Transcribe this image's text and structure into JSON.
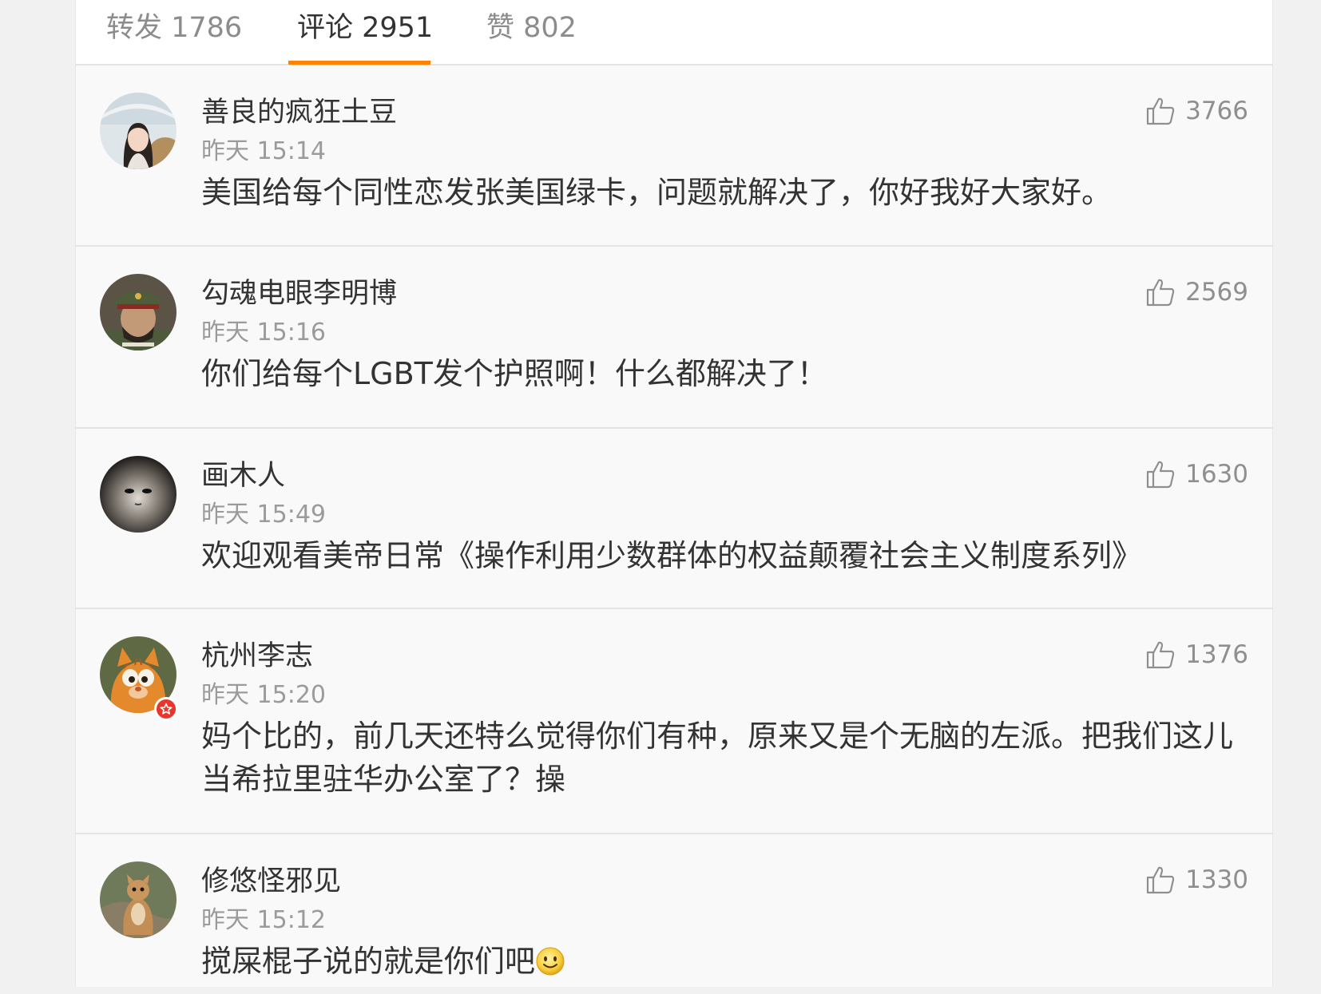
{
  "tabs": {
    "repost": "转发 1786",
    "comment": "评论 2951",
    "like": "赞 802"
  },
  "comments": [
    {
      "user": "善良的疯狂土豆",
      "time": "昨天 15:14",
      "text": "美国给每个同性恋发张美国绿卡，问题就解决了，你好我好大家好。",
      "likes": "3766",
      "avatar": "girl-avatar"
    },
    {
      "user": "勾魂电眼李明博",
      "time": "昨天 15:16",
      "text": "你们给每个LGBT发个护照啊！什么都解决了！",
      "likes": "2569",
      "avatar": "officer-avatar"
    },
    {
      "user": "画木人",
      "time": "昨天 15:49",
      "text": "欢迎观看美帝日常《操作利用少数群体的权益颠覆社会主义制度系列》",
      "likes": "1630",
      "avatar": "mask-avatar"
    },
    {
      "user": "杭州李志",
      "time": "昨天 15:20",
      "text": "妈个比的，前几天还特么觉得你们有种，原来又是个无脑的左派。把我们这儿当希拉里驻华办公室了？操",
      "likes": "1376",
      "avatar": "cat-avatar",
      "verified": true
    },
    {
      "user": "修悠怪邪见",
      "time": "昨天 15:12",
      "text": "搅屎棍子说的就是你们吧",
      "likes": "1330",
      "avatar": "squirrel-avatar",
      "emoji": "smile-emoji"
    }
  ],
  "colors": {
    "accent": "#ff8200",
    "text": "#333333",
    "muted": "#9b9b9b",
    "verified": "#e8352e"
  }
}
